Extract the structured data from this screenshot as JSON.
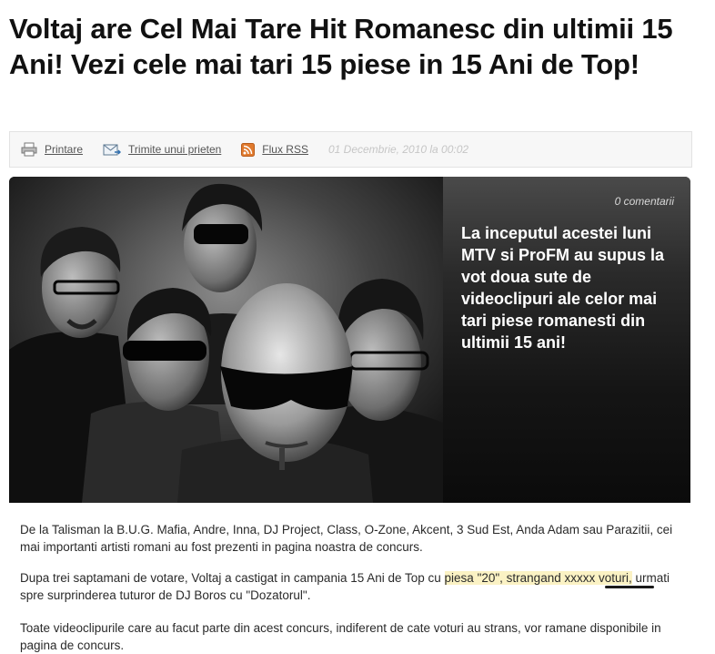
{
  "article": {
    "title": "Voltaj are Cel Mai Tare Hit Romanesc din ultimii 15 Ani! Vezi cele mai tari 15 piese in 15 Ani de Top!"
  },
  "toolbar": {
    "print_label": "Printare",
    "send_label": "Trimite unui prieten",
    "rss_label": "Flux RSS",
    "date": "01 Decembrie, 2010 la 00:02"
  },
  "hero": {
    "comments": "0 comentarii",
    "lead": "La inceputul acestei luni MTV si ProFM au supus la vot doua sute de videoclipuri ale celor mai tari piese romanesti din ultimii 15 ani!"
  },
  "body": {
    "p1": "De la Talisman la B.U.G. Mafia, Andre, Inna, DJ Project, Class, O-Zone, Akcent, 3 Sud Est, Anda Adam sau Parazitii, cei mai importanti artisti romani au fost prezenti in pagina noastra de concurs.",
    "p2_start": "Dupa trei saptamani de votare, Voltaj a castigat in campania 15 Ani de Top cu ",
    "p2_highlight": "piesa \"20\", strangand xxxxx voturi,",
    "p2_end": " urmati spre surprinderea tuturor de DJ Boros cu \"Dozatorul\".",
    "p3": "Toate videoclipurile care au facut parte din acest concurs, indiferent de cate voturi au strans, vor ramane disponibile in pagina de concurs."
  },
  "colors": {
    "highlight": "#fbf2c4",
    "rss_icon": "#e07a2e"
  }
}
